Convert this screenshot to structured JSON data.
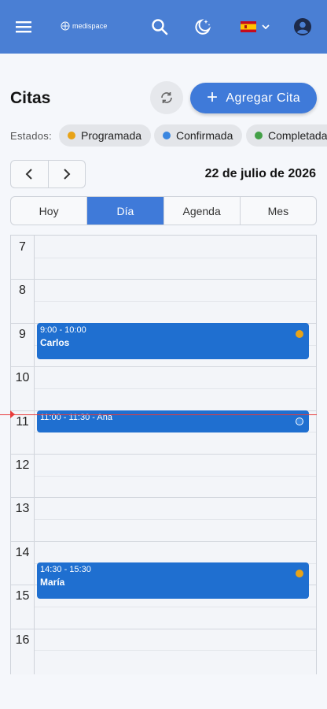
{
  "topbar": {
    "logo_text": "medispace",
    "icons": [
      "menu-icon",
      "search-icon",
      "theme-moon-icon",
      "flag-spain-icon",
      "chevron-down-icon",
      "account-icon"
    ],
    "color": "#4a7fd4"
  },
  "page": {
    "title": "Citas",
    "add_button_label": "Agregar Cita"
  },
  "statuses": {
    "label": "Estados:",
    "chips": [
      {
        "label": "Programada",
        "color": "#e8a317"
      },
      {
        "label": "Confirmada",
        "color": "#3a86e0"
      },
      {
        "label": "Completada",
        "color": "#43a047"
      }
    ]
  },
  "navigation": {
    "date_title": "22 de julio de 2026"
  },
  "views": {
    "tabs": [
      "Hoy",
      "Día",
      "Agenda",
      "Mes"
    ],
    "active": "Día"
  },
  "calendar": {
    "hours": [
      "7",
      "8",
      "9",
      "10",
      "11",
      "12",
      "13",
      "14",
      "15",
      "16"
    ],
    "events": [
      {
        "time": "9:00 - 10:00",
        "name": "Carlos",
        "status_color": "#e8a317"
      },
      {
        "time": "11:00 - 11:30 - Ana",
        "name": "",
        "status_color": "#3a86e0"
      },
      {
        "time": "14:30 - 15:30",
        "name": "María",
        "status_color": "#e8a317"
      }
    ],
    "event_color": "#1f6fd0",
    "now_line_color": "#e83b3b"
  }
}
